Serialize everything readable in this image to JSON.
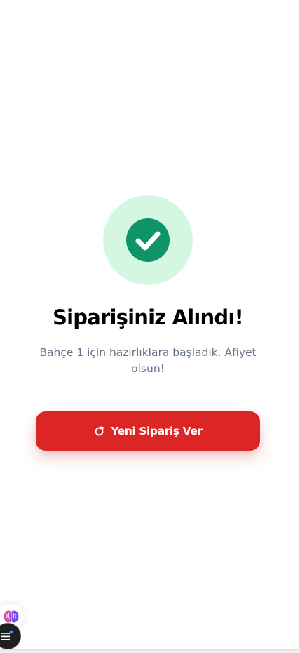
{
  "success": {
    "icon": "check-circle-icon",
    "title": "Siparişiniz Alındı!",
    "message": "Bahçe 1 için hazırlıklara başladık. Afiyet olsun!"
  },
  "actions": {
    "new_order_icon": "refresh-icon",
    "new_order_label": "Yeni Sipariş Ver"
  },
  "floating": {
    "assistant_icon": "brain-icon",
    "menu_icon": "menu-icon"
  },
  "colors": {
    "success_bg": "#d4f7e2",
    "success_icon": "#0e9466",
    "primary_button": "#dc2626",
    "subtitle_text": "#64748b"
  }
}
